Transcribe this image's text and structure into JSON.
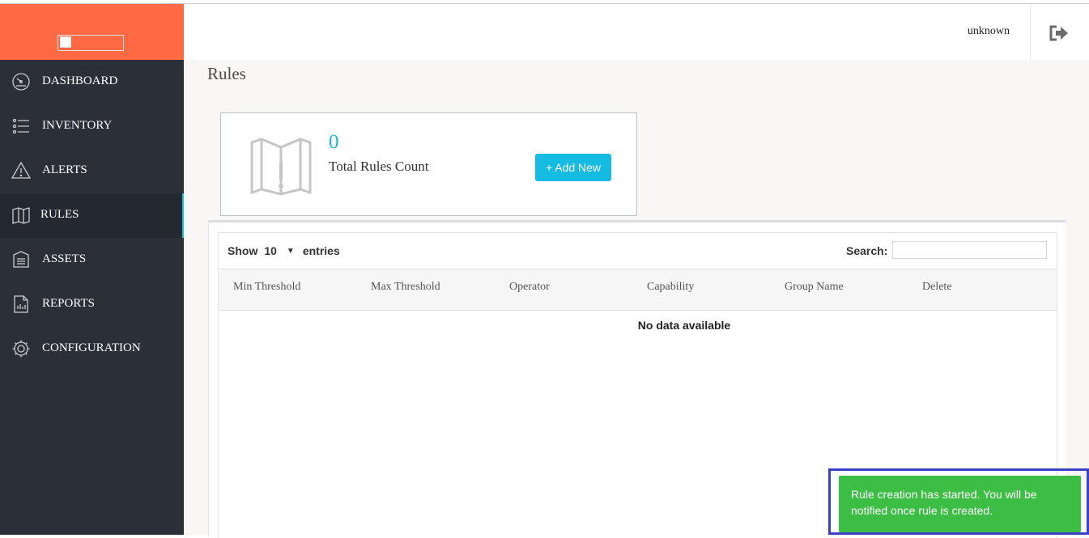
{
  "user": {
    "name": "unknown"
  },
  "sidebar": {
    "items": [
      {
        "label": "DASHBOARD",
        "icon": "speedometer-icon",
        "active": false
      },
      {
        "label": "INVENTORY",
        "icon": "list-icon",
        "active": false
      },
      {
        "label": "ALERTS",
        "icon": "warning-icon",
        "active": false
      },
      {
        "label": "RULES",
        "icon": "book-icon",
        "active": true
      },
      {
        "label": "ASSETS",
        "icon": "assets-icon",
        "active": false
      },
      {
        "label": "REPORTS",
        "icon": "report-icon",
        "active": false
      },
      {
        "label": "CONFIGURATION",
        "icon": "gear-icon",
        "active": false
      }
    ]
  },
  "page": {
    "title": "Rules"
  },
  "stats": {
    "count": "0",
    "label": "Total Rules Count",
    "add_label": "+ Add New"
  },
  "table": {
    "show_label": "Show",
    "page_size": "10",
    "entries_label": "entries",
    "search_label": "Search:",
    "search_value": "",
    "columns": [
      "Min Threshold",
      "Max Threshold",
      "Operator",
      "Capability",
      "Group Name",
      "Delete"
    ],
    "empty_message": "No data available"
  },
  "toast": {
    "message": "Rule creation has started. You will be notified once rule is created."
  },
  "colors": {
    "brand": "#ff6a45",
    "sidebar": "#2b2f38",
    "accent": "#15bbe0",
    "toast": "#3cbe45",
    "highlight_border": "#3c3fc8"
  }
}
